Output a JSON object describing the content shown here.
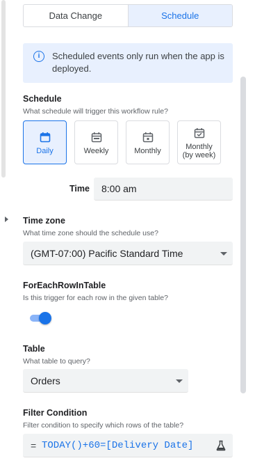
{
  "tabs": [
    {
      "label": "Data Change",
      "active": false
    },
    {
      "label": "Schedule",
      "active": true
    }
  ],
  "info_banner": {
    "icon": "info-icon",
    "text": "Scheduled events only run when the app is deployed."
  },
  "schedule": {
    "title": "Schedule",
    "subtitle": "What schedule will trigger this workflow rule?",
    "options": [
      {
        "label": "Daily",
        "icon": "calendar-day-icon",
        "selected": true
      },
      {
        "label": "Weekly",
        "icon": "calendar-week-icon",
        "selected": false
      },
      {
        "label": "Monthly",
        "icon": "calendar-month-icon",
        "selected": false
      },
      {
        "label_line1": "Monthly",
        "label_line2": "(by week)",
        "icon": "calendar-check-icon",
        "selected": false
      }
    ]
  },
  "time": {
    "label": "Time",
    "value": "8:00 am"
  },
  "timezone": {
    "title": "Time zone",
    "subtitle": "What time zone should the schedule use?",
    "value": "(GMT-07:00) Pacific Standard Time"
  },
  "for_each_row": {
    "title": "ForEachRowInTable",
    "subtitle": "Is this trigger for each row in the given table?",
    "enabled": true
  },
  "table": {
    "title": "Table",
    "subtitle": "What table to query?",
    "value": "Orders"
  },
  "filter": {
    "title": "Filter Condition",
    "subtitle": "Filter condition to specify which rows of the table?",
    "prefix": "=",
    "expression": "TODAY()+60=[Delivery Date]",
    "icon": "flask-icon"
  },
  "colors": {
    "accent": "#1a73e8",
    "accent_light": "#e8f0fe",
    "field_bg": "#f1f3f4"
  }
}
